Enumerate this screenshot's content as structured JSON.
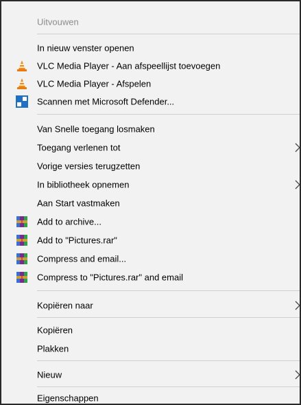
{
  "menu": {
    "items": [
      {
        "label": "Uitvouwen",
        "disabled": true
      },
      {
        "label": "In nieuw venster openen"
      },
      {
        "label": "VLC Media Player - Aan afspeellijst toevoegen",
        "icon": "vlc-cone-icon"
      },
      {
        "label": "VLC Media Player - Afspelen",
        "icon": "vlc-cone-icon"
      },
      {
        "label": "Scannen met Microsoft Defender...",
        "icon": "defender-shield-icon"
      },
      {
        "label": "Van Snelle toegang losmaken"
      },
      {
        "label": "Toegang verlenen tot",
        "submenu": true
      },
      {
        "label": "Vorige versies terugzetten"
      },
      {
        "label": "In bibliotheek opnemen",
        "submenu": true
      },
      {
        "label": "Aan Start vastmaken"
      },
      {
        "label": "Add to archive...",
        "icon": "winrar-icon"
      },
      {
        "label": "Add to \"Pictures.rar\"",
        "icon": "winrar-icon"
      },
      {
        "label": "Compress and email...",
        "icon": "winrar-icon"
      },
      {
        "label": "Compress to \"Pictures.rar\" and email",
        "icon": "winrar-icon"
      },
      {
        "label": "Kopiëren naar",
        "submenu": true
      },
      {
        "label": "Kopiëren"
      },
      {
        "label": "Plakken"
      },
      {
        "label": "Nieuw",
        "submenu": true
      },
      {
        "label": "Eigenschappen"
      }
    ]
  },
  "colors": {
    "menu_bg": "#f2f2f2",
    "disabled_text": "#8c8c8c",
    "separator": "#cfcfcf",
    "vlc_orange": "#f08a12",
    "defender_blue": "#1f6fc5",
    "winrar_purple": "#7a2a8a"
  }
}
